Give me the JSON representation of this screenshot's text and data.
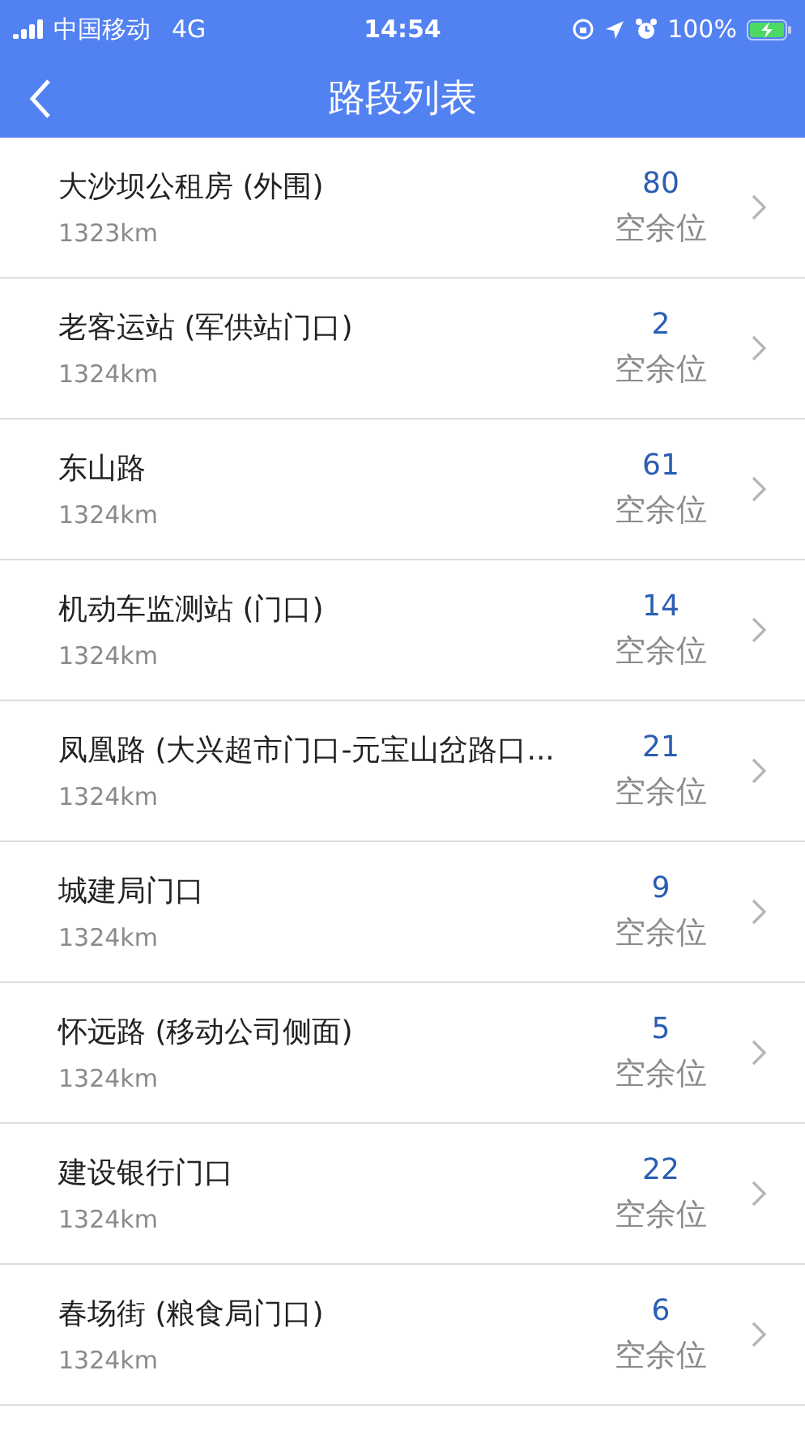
{
  "status_bar": {
    "carrier": "中国移动",
    "network": "4G",
    "time": "14:54",
    "battery": "100%"
  },
  "nav": {
    "title": "路段列表"
  },
  "rows": [
    {
      "name": "大沙坝公租房 (外围)",
      "distance": "1323km",
      "count": "80",
      "count_label": "空余位"
    },
    {
      "name": "老客运站 (军供站门口)",
      "distance": "1324km",
      "count": "2",
      "count_label": "空余位"
    },
    {
      "name": "东山路",
      "distance": "1324km",
      "count": "61",
      "count_label": "空余位"
    },
    {
      "name": "机动车监测站 (门口)",
      "distance": "1324km",
      "count": "14",
      "count_label": "空余位"
    },
    {
      "name": "凤凰路 (大兴超市门口-元宝山岔路口...",
      "distance": "1324km",
      "count": "21",
      "count_label": "空余位"
    },
    {
      "name": "城建局门口",
      "distance": "1324km",
      "count": "9",
      "count_label": "空余位"
    },
    {
      "name": "怀远路 (移动公司侧面)",
      "distance": "1324km",
      "count": "5",
      "count_label": "空余位"
    },
    {
      "name": "建设银行门口",
      "distance": "1324km",
      "count": "22",
      "count_label": "空余位"
    },
    {
      "name": "春场街 (粮食局门口)",
      "distance": "1324km",
      "count": "6",
      "count_label": "空余位"
    }
  ]
}
